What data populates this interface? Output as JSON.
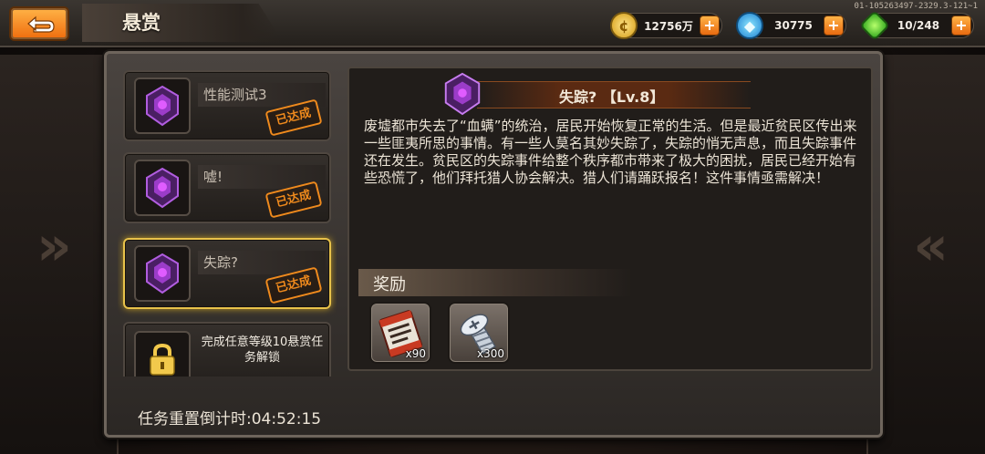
{
  "header": {
    "title": "悬赏",
    "version": "01-105263497-2329.3-121~1"
  },
  "resources": {
    "gold": {
      "value": "12756万",
      "icon": "gold-coin-icon",
      "color": "#f0b429"
    },
    "gems": {
      "value": "30775",
      "icon": "gem-icon",
      "color": "#2fa3e8"
    },
    "energy": {
      "value": "10/248",
      "icon": "energy-crystal-icon",
      "color": "#45c22a"
    },
    "plus_label": "+"
  },
  "quests": [
    {
      "name": "性能测试3",
      "status": "已达成",
      "selected": false
    },
    {
      "name": "嘘!",
      "status": "已达成",
      "selected": false
    },
    {
      "name": "失踪?",
      "status": "已达成",
      "selected": true
    }
  ],
  "locked_quest": {
    "text": "完成任意等级10悬赏任务解锁"
  },
  "detail": {
    "title": "失踪? 【Lv.8】",
    "description": "废墟都市失去了“血螨”的统治，居民开始恢复正常的生活。但是最近贫民区传出来一些匪夷所思的事情。有一些人莫名其妙失踪了，失踪的悄无声息，而且失踪事件还在发生。贫民区的失踪事件给整个秩序都市带来了极大的困扰，居民已经开始有些恐慌了，他们拜托猎人协会解决。猎人们请踊跃报名！这件事情亟需解决！",
    "reward_label": "奖励",
    "rewards": [
      {
        "icon": "ticket-scroll-icon",
        "qty": "x90"
      },
      {
        "icon": "screw-bolt-icon",
        "qty": "x300"
      }
    ]
  },
  "timer": {
    "text": "任务重置倒计时:04:52:15"
  },
  "colors": {
    "accent_orange": "#ef8a1d",
    "selected_border": "#e8c24a",
    "emblem_purple": "#9b3cc9"
  }
}
